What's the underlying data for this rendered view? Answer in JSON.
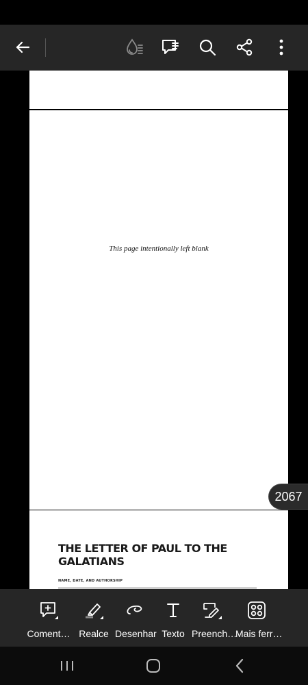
{
  "toolbar": {
    "back_icon": "arrow-left-icon",
    "icons": [
      "liquid-mode-icon",
      "comments-icon",
      "search-icon",
      "share-icon",
      "more-vertical-icon"
    ]
  },
  "document": {
    "blank_page_text": "This page intentionally left blank",
    "chapter_title": "THE LETTER OF PAUL TO THE GALATIANS",
    "section_heading": "NAME, DATE, AND AUTHORSHIP"
  },
  "page_indicator": "2067",
  "tools": [
    {
      "label": "Coment…",
      "icon": "comment-add-icon"
    },
    {
      "label": "Realce",
      "icon": "highlighter-icon"
    },
    {
      "label": "Desenhar",
      "icon": "draw-icon"
    },
    {
      "label": "Texto",
      "icon": "text-icon"
    },
    {
      "label": "Preench…",
      "icon": "fill-sign-icon"
    },
    {
      "label": "Mais ferr…",
      "icon": "more-tools-icon"
    }
  ],
  "navigation": [
    "recent-apps-icon",
    "home-icon",
    "back-icon"
  ],
  "colors": {
    "toolbar": "#262626",
    "page": "#ffffff",
    "background": "#000000"
  }
}
